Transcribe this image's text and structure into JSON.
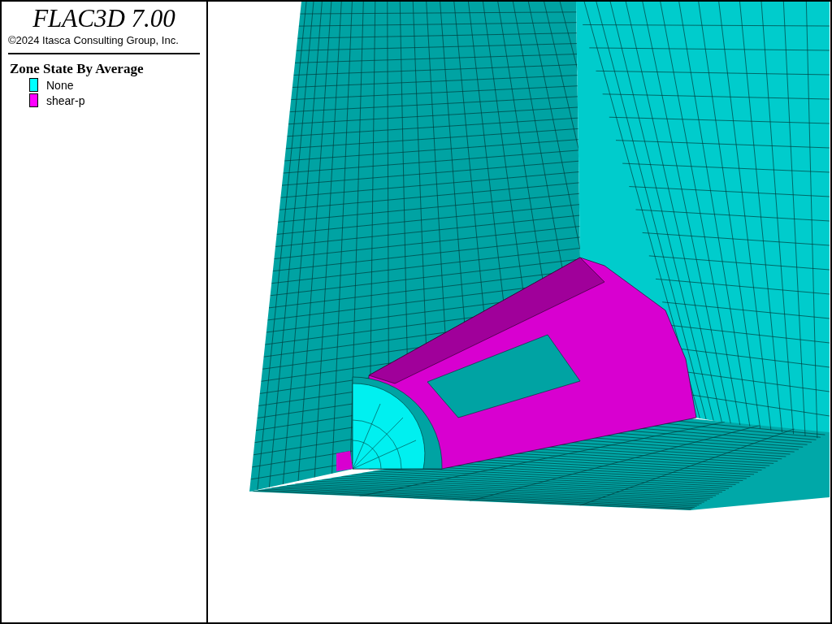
{
  "header": {
    "title": "FLAC3D 7.00",
    "copyright": "©2024 Itasca Consulting Group, Inc."
  },
  "legend": {
    "title": "Zone State By Average",
    "items": [
      {
        "label": "None",
        "color": "#00ffff"
      },
      {
        "label": "shear-p",
        "color": "#ff00ff"
      }
    ]
  }
}
